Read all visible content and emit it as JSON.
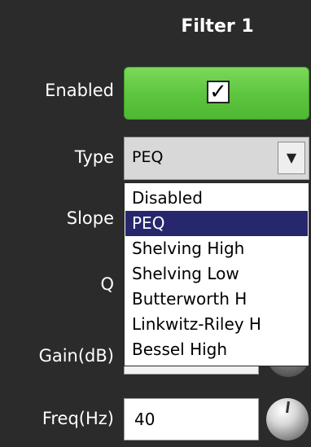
{
  "header": {
    "title": "Filter 1"
  },
  "labels": {
    "enabled": "Enabled",
    "type": "Type",
    "slope": "Slope",
    "q": "Q",
    "gain": "Gain(dB)",
    "freq": "Freq(Hz)"
  },
  "enabled": {
    "checked": true,
    "check_glyph": "✓"
  },
  "type_select": {
    "value": "PEQ",
    "arrow_glyph": "▼",
    "options": [
      "Disabled",
      "PEQ",
      "Shelving High",
      "Shelving Low",
      "Butterworth H",
      "Linkwitz-Riley H",
      "Bessel High"
    ],
    "selected_index": 1
  },
  "freq_input": {
    "value": "40"
  },
  "colors": {
    "background": "#2b2b2b",
    "enabled_green": "#5cc43d",
    "selection": "#27276e"
  }
}
